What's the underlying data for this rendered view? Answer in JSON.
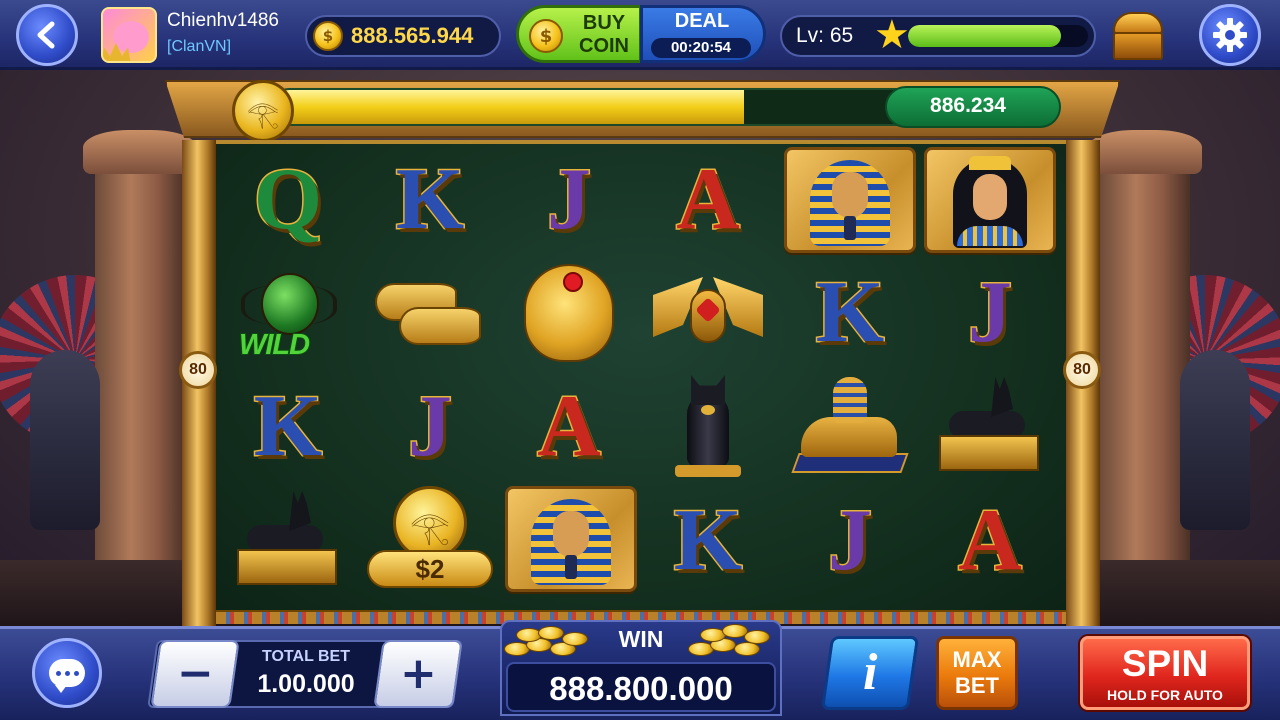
{
  "player": {
    "name": "Chienhv1486",
    "clan": "[ClanVN]"
  },
  "coins": {
    "balance": "888.565.944",
    "coin_symbol": "$"
  },
  "buy_coin": {
    "label_line1": "BUY",
    "label_line2": "COIN"
  },
  "deal": {
    "label": "DEAL",
    "timer": "00:20:54"
  },
  "level": {
    "text": "Lv: 65",
    "progress": 0.85
  },
  "jackpot": {
    "value": "886.234",
    "progress": 0.6
  },
  "lines": {
    "left": "80",
    "right": "80"
  },
  "reels": {
    "symbols": [
      [
        "Q",
        "WILD scarab",
        "K",
        "Anubis"
      ],
      [
        "K",
        "golden sandals",
        "J",
        "$2 coin"
      ],
      [
        "J",
        "golden scarab",
        "A",
        "Pharaoh"
      ],
      [
        "A",
        "winged scarab",
        "black cat",
        "K"
      ],
      [
        "Pharaoh",
        "K",
        "sphinx",
        "J"
      ],
      [
        "Queen",
        "J",
        "Anubis",
        "A"
      ]
    ],
    "wild_label": "WILD",
    "coin_prize": "$2",
    "letters": {
      "q": "Q",
      "k": "K",
      "j": "J",
      "a": "A"
    }
  },
  "bottom": {
    "total_bet_label": "TOTAL BET",
    "total_bet_value": "1.00.000",
    "minus": "−",
    "plus": "+",
    "win_label": "WIN",
    "win_value": "888.800.000",
    "info": "i",
    "max_bet_line1": "MAX",
    "max_bet_line2": "BET",
    "spin_label": "SPIN",
    "spin_sub": "HOLD FOR AUTO"
  },
  "colors": {
    "accent_blue": "#2f4bc8",
    "gold": "#f3cf19",
    "green": "#61c21a",
    "spin_red": "#e0261e",
    "reel_bg": "#14301f"
  },
  "icons": [
    "back-arrow-icon",
    "settings-gear-icon",
    "treasure-chest-icon",
    "star-icon",
    "coin-icon",
    "eye-of-horus-icon",
    "chat-bubble-icon"
  ]
}
